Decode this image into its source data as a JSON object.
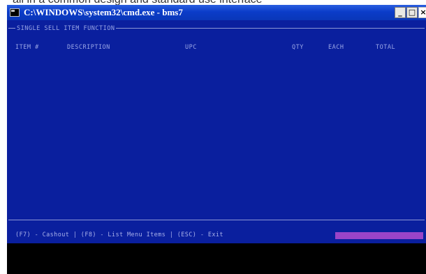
{
  "caption": "all in a common design and standard use interface",
  "window": {
    "title": "C:\\WINDOWS\\system32\\cmd.exe - bms7",
    "icon": "console-icon",
    "buttons": {
      "minimize": "_",
      "maximize": "□",
      "close": "×"
    }
  },
  "screen": {
    "section_title": "SINGLE SELL ITEM FUNCTION",
    "columns": [
      "ITEM #",
      "DESCRIPTION",
      "UPC",
      "QTY",
      "EACH",
      "TOTAL"
    ],
    "footer": "(F7) - Cashout | (F8) - List Menu Items | (ESC) - Exit"
  },
  "colors": {
    "console_bg": "#0a1f9e",
    "text": "#9aa6e6",
    "status_bar": "#9a44c8",
    "titlebar": "#0b3cc9"
  }
}
